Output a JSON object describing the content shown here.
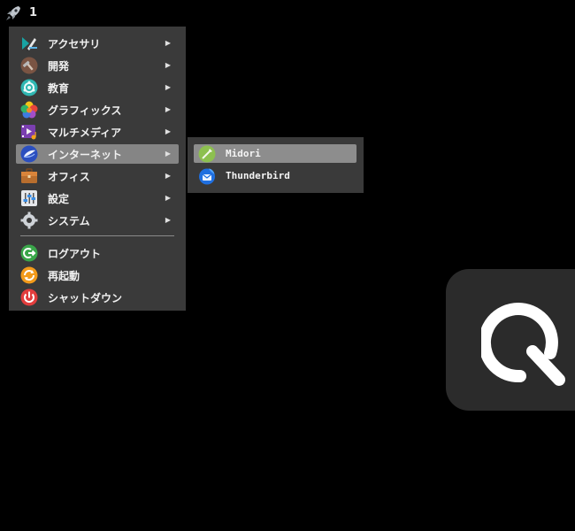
{
  "topbar": {
    "launcher_icon": "rocket-icon",
    "workspace": "1"
  },
  "menu": {
    "items": [
      {
        "label": "アクセサリ",
        "icon": "accessories-icon",
        "submenu": true
      },
      {
        "label": "開発",
        "icon": "development-icon",
        "submenu": true
      },
      {
        "label": "教育",
        "icon": "education-icon",
        "submenu": true
      },
      {
        "label": "グラフィックス",
        "icon": "graphics-icon",
        "submenu": true
      },
      {
        "label": "マルチメディア",
        "icon": "multimedia-icon",
        "submenu": true
      },
      {
        "label": "インターネット",
        "icon": "internet-icon",
        "submenu": true,
        "active": true
      },
      {
        "label": "オフィス",
        "icon": "office-icon",
        "submenu": true
      },
      {
        "label": "設定",
        "icon": "settings-icon",
        "submenu": true
      },
      {
        "label": "システム",
        "icon": "system-icon",
        "submenu": true
      }
    ],
    "arrow": "▶",
    "session": [
      {
        "label": "ログアウト",
        "icon": "logout-icon"
      },
      {
        "label": "再起動",
        "icon": "reboot-icon"
      },
      {
        "label": "シャットダウン",
        "icon": "shutdown-icon"
      }
    ]
  },
  "submenu": {
    "items": [
      {
        "label": "Midori",
        "icon": "midori-icon",
        "active": true
      },
      {
        "label": "Thunderbird",
        "icon": "thunderbird-icon"
      }
    ]
  },
  "overlay": {
    "icon": "q-logo-icon"
  },
  "colors": {
    "background": "#000000",
    "menu_bg": "#3a3a3a",
    "highlight": "#858585",
    "accent_logout": "#3aa64a",
    "accent_reboot": "#f29a1a",
    "accent_shutdown": "#e23d3d"
  }
}
